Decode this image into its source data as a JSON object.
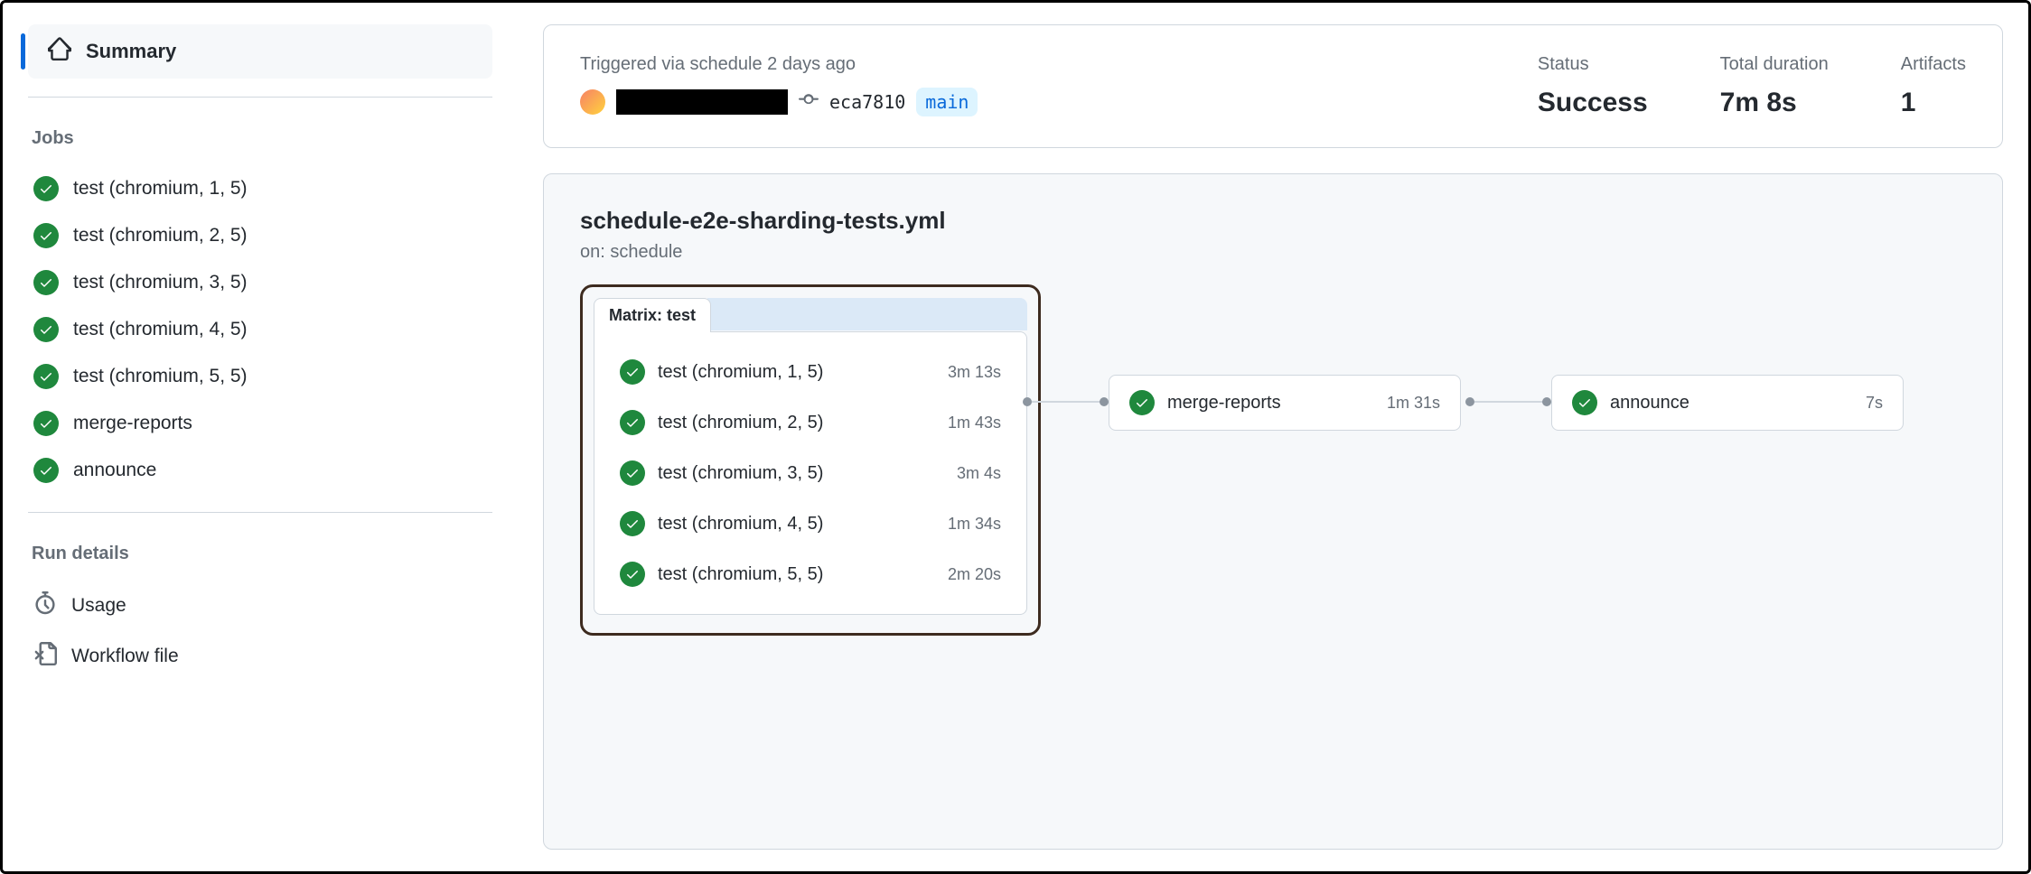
{
  "sidebar": {
    "summary_label": "Summary",
    "jobs_label": "Jobs",
    "jobs": [
      "test (chromium, 1, 5)",
      "test (chromium, 2, 5)",
      "test (chromium, 3, 5)",
      "test (chromium, 4, 5)",
      "test (chromium, 5, 5)",
      "merge-reports",
      "announce"
    ],
    "run_details_label": "Run details",
    "usage_label": "Usage",
    "workflow_file_label": "Workflow file"
  },
  "header": {
    "trigger_label": "Triggered via schedule 2 days ago",
    "commit_sha": "eca7810",
    "branch": "main",
    "status_label": "Status",
    "status_value": "Success",
    "duration_label": "Total duration",
    "duration_value": "7m 8s",
    "artifacts_label": "Artifacts",
    "artifacts_value": "1"
  },
  "workflow": {
    "title": "schedule-e2e-sharding-tests.yml",
    "trigger": "on: schedule",
    "matrix_tab": "Matrix: test",
    "matrix_jobs": [
      {
        "name": "test (chromium, 1, 5)",
        "duration": "3m 13s"
      },
      {
        "name": "test (chromium, 2, 5)",
        "duration": "1m 43s"
      },
      {
        "name": "test (chromium, 3, 5)",
        "duration": "3m 4s"
      },
      {
        "name": "test (chromium, 4, 5)",
        "duration": "1m 34s"
      },
      {
        "name": "test (chromium, 5, 5)",
        "duration": "2m 20s"
      }
    ],
    "merge_reports": {
      "name": "merge-reports",
      "duration": "1m 31s"
    },
    "announce": {
      "name": "announce",
      "duration": "7s"
    }
  }
}
